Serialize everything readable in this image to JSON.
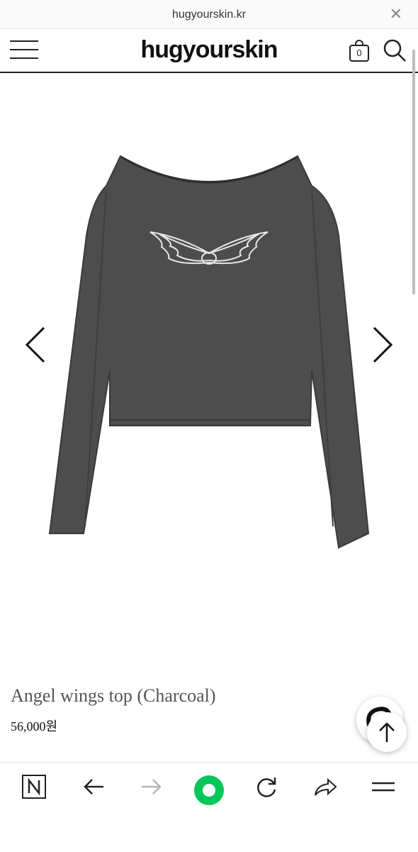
{
  "browser": {
    "url": "hugyourskin.kr",
    "close_icon": "close-icon"
  },
  "header": {
    "logo": "hugyourskin",
    "cart_count": "0",
    "icons": [
      "hamburger-menu-icon",
      "shopping-bag-icon",
      "search-icon"
    ]
  },
  "product": {
    "name": "Angel wings top (Charcoal)",
    "price": "56,000원",
    "image_description_icon": "charcoal-long-sleeve-top-with-angel-wings",
    "colors": {
      "garment": "#4a4a4a",
      "wings": "#e8e8e8"
    }
  },
  "gallery": {
    "prev_icon": "chevron-left-icon",
    "next_icon": "chevron-right-icon"
  },
  "floating": {
    "chat_icon": "chat-bubble-icon",
    "top_icon": "arrow-up-icon"
  },
  "toolbar": {
    "items": [
      "naver-home-icon",
      "back-arrow-icon",
      "forward-arrow-icon",
      "green-dot-icon",
      "refresh-icon",
      "share-icon",
      "menu-icon"
    ],
    "accent": "#03c75a"
  }
}
